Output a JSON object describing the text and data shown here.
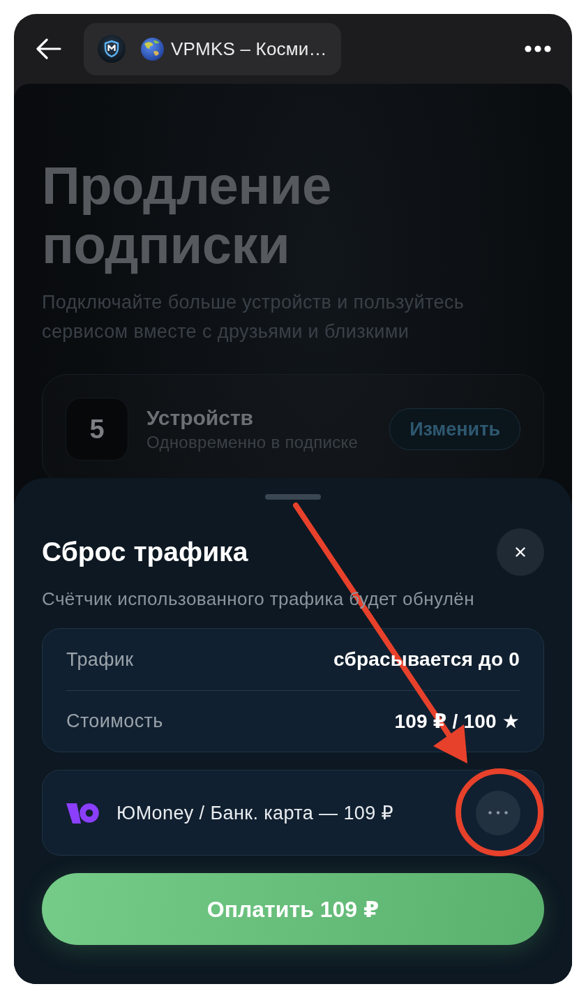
{
  "header": {
    "tab_title": "VPMKS – Косми…"
  },
  "page": {
    "title": "Продление подписки",
    "subtitle": "Подключайте больше устройств и пользуйтесь сервисом вместе с друзьями и близкими",
    "devices": {
      "count": "5",
      "title": "Устройств",
      "caption": "Одновременно в подписке",
      "button": "Изменить"
    }
  },
  "sheet": {
    "title": "Сброс трафика",
    "description": "Счётчик использованного трафика будет обнулён",
    "details": [
      {
        "label": "Трафик",
        "value": "сбрасывается до 0"
      },
      {
        "label": "Стоимость",
        "value": "109 ₽ / 100 ★"
      }
    ],
    "payment_method": "ЮMoney / Банк. карта — 109 ₽",
    "pay_button": "Оплатить 109 ₽"
  }
}
